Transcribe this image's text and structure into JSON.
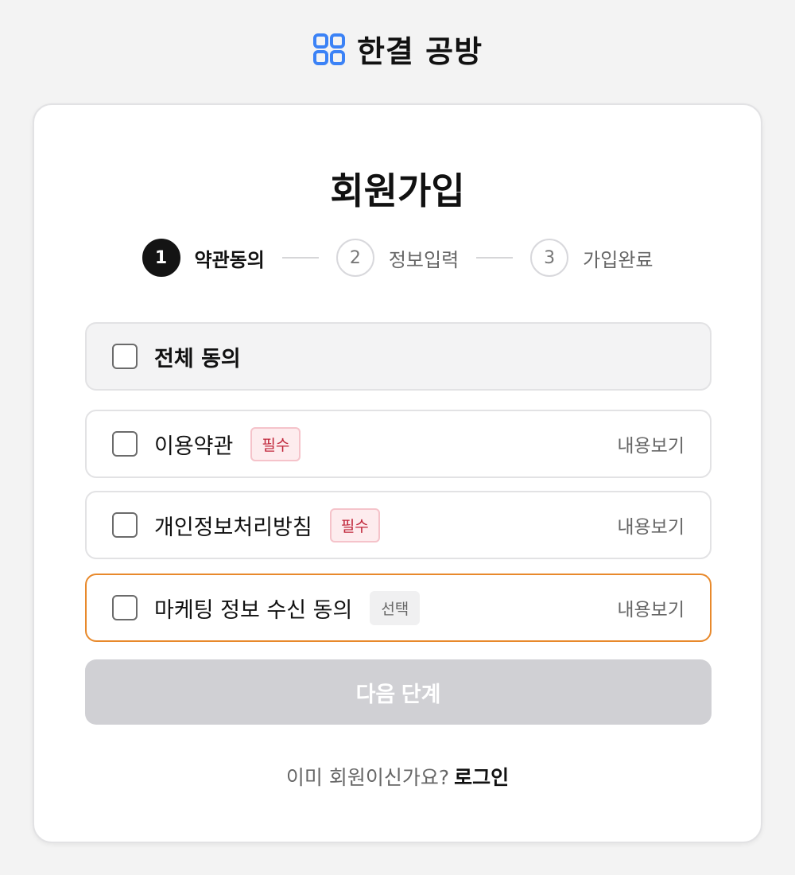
{
  "brand": {
    "name": "한결 공방",
    "icon": "grid-logo-icon",
    "accent": "#3b82f6"
  },
  "page_title": "회원가입",
  "steps": [
    {
      "number": "1",
      "label": "약관동의",
      "active": true
    },
    {
      "number": "2",
      "label": "정보입력",
      "active": false
    },
    {
      "number": "3",
      "label": "가입완료",
      "active": false
    }
  ],
  "agree_all": {
    "label": "전체 동의",
    "checked": false
  },
  "terms": [
    {
      "label": "이용약관",
      "badge": "필수",
      "view": "내용보기",
      "checked": false
    },
    {
      "label": "개인정보처리방침",
      "badge": "필수",
      "view": "내용보기",
      "checked": false
    },
    {
      "label": "마케팅 정보 수신 동의",
      "badge": "선택",
      "view": "내용보기",
      "checked": false
    }
  ],
  "next_button": "다음 단계",
  "footer": {
    "prompt": "이미 회원이신가요?",
    "login": "로그인"
  },
  "colors": {
    "focus_border": "#e8892b",
    "required_badge": "#c0263a",
    "disabled_button": "#d0d0d4"
  }
}
